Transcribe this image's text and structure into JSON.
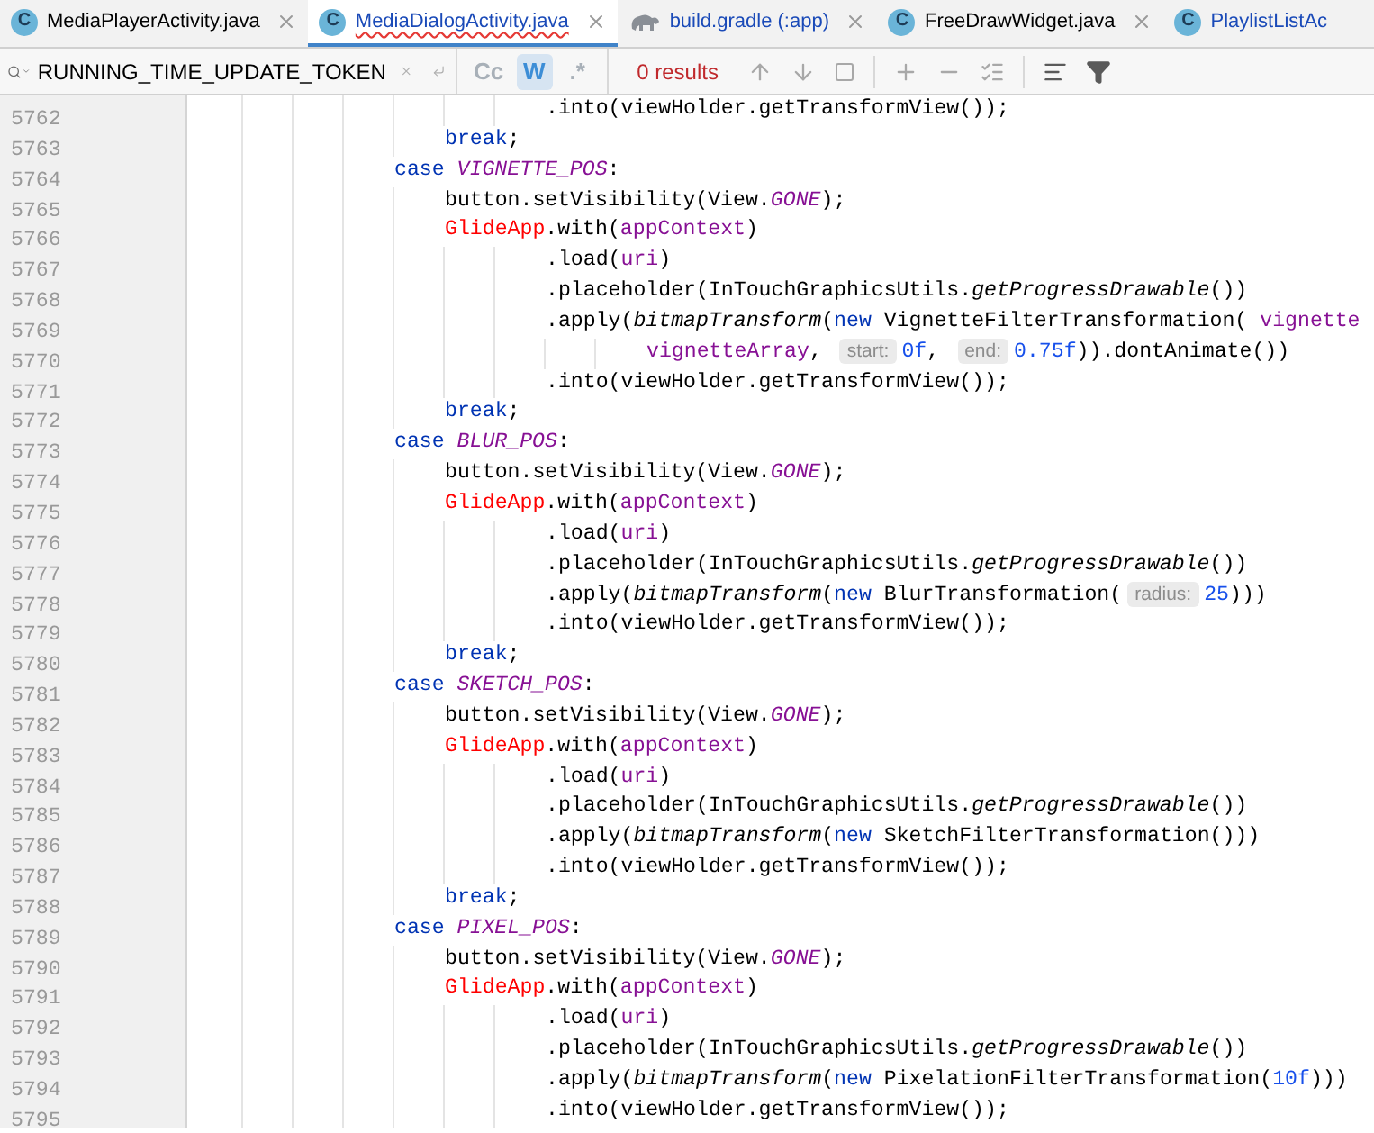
{
  "tabs": [
    {
      "kind": "java",
      "badge": "C",
      "label": "MediaPlayerActivity.java",
      "color": "#000000",
      "selected": false,
      "error": false,
      "closable": true
    },
    {
      "kind": "java",
      "badge": "C",
      "label": "MediaDialogActivity.java",
      "color": "#1a4ab8",
      "selected": true,
      "error": true,
      "closable": true
    },
    {
      "kind": "gradle",
      "label": "build.gradle (:app)",
      "color": "#1a4ab8",
      "selected": false,
      "error": false,
      "closable": true
    },
    {
      "kind": "java",
      "badge": "C",
      "label": "FreeDrawWidget.java",
      "color": "#000000",
      "selected": false,
      "error": false,
      "closable": true
    },
    {
      "kind": "java",
      "badge": "C",
      "label": "PlaylistListAc",
      "color": "#1a4ab8",
      "selected": false,
      "error": false,
      "closable": false
    }
  ],
  "search": {
    "query": "RUNNING_TIME_UPDATE_TOKEN",
    "toggles": [
      {
        "label": "Cc",
        "selected": false
      },
      {
        "label": "W",
        "selected": true
      },
      {
        "label": ".*",
        "selected": false
      }
    ],
    "results": "0 results"
  },
  "editor": {
    "lines": [
      {
        "number": "5762",
        "kind": "chain",
        "tokens": [
          {
            "kind": "plain",
            "text": ".into(viewHolder.getTransformView());"
          }
        ]
      },
      {
        "number": "5763",
        "kind": "body",
        "tokens": [
          {
            "kind": "keyword",
            "text": "break"
          },
          {
            "kind": "plain",
            "text": ";"
          }
        ]
      },
      {
        "number": "5764",
        "kind": "case",
        "tokens": [
          {
            "kind": "keyword",
            "text": "case "
          },
          {
            "kind": "constant",
            "text": "VIGNETTE_POS"
          },
          {
            "kind": "plain",
            "text": ":"
          }
        ]
      },
      {
        "number": "5765",
        "kind": "body",
        "tokens": [
          {
            "kind": "plain",
            "text": "button.setVisibility(View."
          },
          {
            "kind": "constant",
            "text": "GONE"
          },
          {
            "kind": "plain",
            "text": ");"
          }
        ]
      },
      {
        "number": "5766",
        "kind": "body",
        "tokens": [
          {
            "kind": "class",
            "text": "GlideApp"
          },
          {
            "kind": "plain",
            "text": ".with("
          },
          {
            "kind": "field",
            "text": "appContext"
          },
          {
            "kind": "plain",
            "text": ")"
          }
        ]
      },
      {
        "number": "5767",
        "kind": "chain",
        "tokens": [
          {
            "kind": "plain",
            "text": ".load("
          },
          {
            "kind": "field",
            "text": "uri"
          },
          {
            "kind": "plain",
            "text": ")"
          }
        ]
      },
      {
        "number": "5768",
        "kind": "chain",
        "tokens": [
          {
            "kind": "plain",
            "text": ".placeholder(InTouchGraphicsUtils."
          },
          {
            "kind": "method",
            "text": "getProgressDrawable"
          },
          {
            "kind": "plain",
            "text": "())"
          }
        ]
      },
      {
        "number": "5769",
        "kind": "chain",
        "tokens": [
          {
            "kind": "plain",
            "text": ".apply("
          },
          {
            "kind": "method",
            "text": "bitmapTransform"
          },
          {
            "kind": "plain",
            "text": "("
          },
          {
            "kind": "keyword",
            "text": "new"
          },
          {
            "kind": "plain",
            "text": " VignetteFilterTransformation( "
          },
          {
            "kind": "field",
            "text": "vignette"
          }
        ]
      },
      {
        "number": "5770",
        "kind": "wrap",
        "tokens": [
          {
            "kind": "field",
            "text": "vignetteArray"
          },
          {
            "kind": "plain",
            "text": ", "
          },
          {
            "kind": "hint",
            "text": "start:"
          },
          {
            "kind": "number",
            "text": "0f"
          },
          {
            "kind": "plain",
            "text": ", "
          },
          {
            "kind": "hint",
            "text": "end:"
          },
          {
            "kind": "number",
            "text": "0.75f"
          },
          {
            "kind": "plain",
            "text": ")).dontAnimate())"
          }
        ]
      },
      {
        "number": "5771",
        "kind": "chain",
        "tokens": [
          {
            "kind": "plain",
            "text": ".into(viewHolder.getTransformView());"
          }
        ]
      },
      {
        "number": "5772",
        "kind": "body",
        "tokens": [
          {
            "kind": "keyword",
            "text": "break"
          },
          {
            "kind": "plain",
            "text": ";"
          }
        ]
      },
      {
        "number": "5773",
        "kind": "case",
        "tokens": [
          {
            "kind": "keyword",
            "text": "case "
          },
          {
            "kind": "constant",
            "text": "BLUR_POS"
          },
          {
            "kind": "plain",
            "text": ":"
          }
        ]
      },
      {
        "number": "5774",
        "kind": "body",
        "tokens": [
          {
            "kind": "plain",
            "text": "button.setVisibility(View."
          },
          {
            "kind": "constant",
            "text": "GONE"
          },
          {
            "kind": "plain",
            "text": ");"
          }
        ]
      },
      {
        "number": "5775",
        "kind": "body",
        "tokens": [
          {
            "kind": "class",
            "text": "GlideApp"
          },
          {
            "kind": "plain",
            "text": ".with("
          },
          {
            "kind": "field",
            "text": "appContext"
          },
          {
            "kind": "plain",
            "text": ")"
          }
        ]
      },
      {
        "number": "5776",
        "kind": "chain",
        "tokens": [
          {
            "kind": "plain",
            "text": ".load("
          },
          {
            "kind": "field",
            "text": "uri"
          },
          {
            "kind": "plain",
            "text": ")"
          }
        ]
      },
      {
        "number": "5777",
        "kind": "chain",
        "tokens": [
          {
            "kind": "plain",
            "text": ".placeholder(InTouchGraphicsUtils."
          },
          {
            "kind": "method",
            "text": "getProgressDrawable"
          },
          {
            "kind": "plain",
            "text": "())"
          }
        ]
      },
      {
        "number": "5778",
        "kind": "chain",
        "tokens": [
          {
            "kind": "plain",
            "text": ".apply("
          },
          {
            "kind": "method",
            "text": "bitmapTransform"
          },
          {
            "kind": "plain",
            "text": "("
          },
          {
            "kind": "keyword",
            "text": "new"
          },
          {
            "kind": "plain",
            "text": " BlurTransformation("
          },
          {
            "kind": "hint",
            "text": "radius:"
          },
          {
            "kind": "number",
            "text": "25"
          },
          {
            "kind": "plain",
            "text": ")))"
          }
        ]
      },
      {
        "number": "5779",
        "kind": "chain",
        "tokens": [
          {
            "kind": "plain",
            "text": ".into(viewHolder.getTransformView());"
          }
        ]
      },
      {
        "number": "5780",
        "kind": "body",
        "tokens": [
          {
            "kind": "keyword",
            "text": "break"
          },
          {
            "kind": "plain",
            "text": ";"
          }
        ]
      },
      {
        "number": "5781",
        "kind": "case",
        "tokens": [
          {
            "kind": "keyword",
            "text": "case "
          },
          {
            "kind": "constant",
            "text": "SKETCH_POS"
          },
          {
            "kind": "plain",
            "text": ":"
          }
        ]
      },
      {
        "number": "5782",
        "kind": "body",
        "tokens": [
          {
            "kind": "plain",
            "text": "button.setVisibility(View."
          },
          {
            "kind": "constant",
            "text": "GONE"
          },
          {
            "kind": "plain",
            "text": ");"
          }
        ]
      },
      {
        "number": "5783",
        "kind": "body",
        "tokens": [
          {
            "kind": "class",
            "text": "GlideApp"
          },
          {
            "kind": "plain",
            "text": ".with("
          },
          {
            "kind": "field",
            "text": "appContext"
          },
          {
            "kind": "plain",
            "text": ")"
          }
        ]
      },
      {
        "number": "5784",
        "kind": "chain",
        "tokens": [
          {
            "kind": "plain",
            "text": ".load("
          },
          {
            "kind": "field",
            "text": "uri"
          },
          {
            "kind": "plain",
            "text": ")"
          }
        ]
      },
      {
        "number": "5785",
        "kind": "chain",
        "tokens": [
          {
            "kind": "plain",
            "text": ".placeholder(InTouchGraphicsUtils."
          },
          {
            "kind": "method",
            "text": "getProgressDrawable"
          },
          {
            "kind": "plain",
            "text": "())"
          }
        ]
      },
      {
        "number": "5786",
        "kind": "chain",
        "tokens": [
          {
            "kind": "plain",
            "text": ".apply("
          },
          {
            "kind": "method",
            "text": "bitmapTransform"
          },
          {
            "kind": "plain",
            "text": "("
          },
          {
            "kind": "keyword",
            "text": "new"
          },
          {
            "kind": "plain",
            "text": " SketchFilterTransformation()))"
          }
        ]
      },
      {
        "number": "5787",
        "kind": "chain",
        "tokens": [
          {
            "kind": "plain",
            "text": ".into(viewHolder.getTransformView());"
          }
        ]
      },
      {
        "number": "5788",
        "kind": "body",
        "tokens": [
          {
            "kind": "keyword",
            "text": "break"
          },
          {
            "kind": "plain",
            "text": ";"
          }
        ]
      },
      {
        "number": "5789",
        "kind": "case",
        "tokens": [
          {
            "kind": "keyword",
            "text": "case "
          },
          {
            "kind": "constant",
            "text": "PIXEL_POS"
          },
          {
            "kind": "plain",
            "text": ":"
          }
        ]
      },
      {
        "number": "5790",
        "kind": "body",
        "tokens": [
          {
            "kind": "plain",
            "text": "button.setVisibility(View."
          },
          {
            "kind": "constant",
            "text": "GONE"
          },
          {
            "kind": "plain",
            "text": ");"
          }
        ]
      },
      {
        "number": "5791",
        "kind": "body",
        "tokens": [
          {
            "kind": "class",
            "text": "GlideApp"
          },
          {
            "kind": "plain",
            "text": ".with("
          },
          {
            "kind": "field",
            "text": "appContext"
          },
          {
            "kind": "plain",
            "text": ")"
          }
        ]
      },
      {
        "number": "5792",
        "kind": "chain",
        "tokens": [
          {
            "kind": "plain",
            "text": ".load("
          },
          {
            "kind": "field",
            "text": "uri"
          },
          {
            "kind": "plain",
            "text": ")"
          }
        ]
      },
      {
        "number": "5793",
        "kind": "chain",
        "tokens": [
          {
            "kind": "plain",
            "text": ".placeholder(InTouchGraphicsUtils."
          },
          {
            "kind": "method",
            "text": "getProgressDrawable"
          },
          {
            "kind": "plain",
            "text": "())"
          }
        ]
      },
      {
        "number": "5794",
        "kind": "chain",
        "tokens": [
          {
            "kind": "plain",
            "text": ".apply("
          },
          {
            "kind": "method",
            "text": "bitmapTransform"
          },
          {
            "kind": "plain",
            "text": "("
          },
          {
            "kind": "keyword",
            "text": "new"
          },
          {
            "kind": "plain",
            "text": " PixelationFilterTransformation("
          },
          {
            "kind": "number",
            "text": "10f"
          },
          {
            "kind": "plain",
            "text": ")))"
          }
        ]
      },
      {
        "number": "5795",
        "kind": "chain",
        "tokens": [
          {
            "kind": "plain",
            "text": ".into(viewHolder.getTransformView());"
          }
        ]
      }
    ]
  }
}
